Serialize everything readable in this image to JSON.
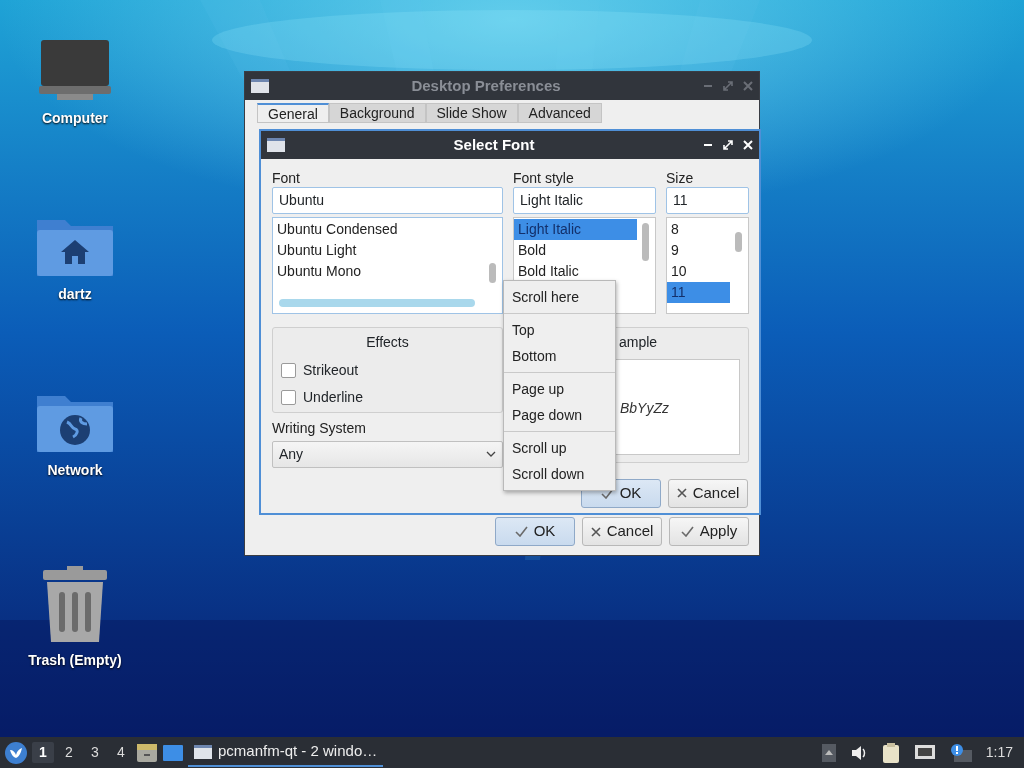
{
  "desktop_icons": [
    {
      "label": "Computer",
      "kind": "computer"
    },
    {
      "label": "dartz",
      "kind": "home"
    },
    {
      "label": "Network",
      "kind": "network"
    },
    {
      "label": "Trash (Empty)",
      "kind": "trash"
    }
  ],
  "back_window": {
    "title": "Desktop Preferences",
    "tabs": [
      {
        "label": "General",
        "selected": true
      },
      {
        "label": "Background",
        "selected": false
      },
      {
        "label": "Slide Show",
        "selected": false
      },
      {
        "label": "Advanced",
        "selected": false
      }
    ],
    "buttons": [
      {
        "label": "OK",
        "kind": "ok",
        "default": true
      },
      {
        "label": "Cancel",
        "kind": "cancel",
        "default": false
      },
      {
        "label": "Apply",
        "kind": "ok",
        "default": false
      }
    ]
  },
  "dialog": {
    "title": "Select Font",
    "font_label": "Font",
    "font_value": "Ubuntu",
    "fonts": [
      {
        "label": "Ubuntu Condensed",
        "selected": false
      },
      {
        "label": "Ubuntu Light",
        "selected": false
      },
      {
        "label": "Ubuntu Mono",
        "selected": false
      }
    ],
    "style_label": "Font style",
    "style_value": "Light Italic",
    "styles": [
      {
        "label": "Light Italic",
        "selected": true
      },
      {
        "label": "Bold",
        "selected": false
      },
      {
        "label": "Bold Italic",
        "selected": false
      }
    ],
    "size_label": "Size",
    "size_value": "11",
    "sizes": [
      {
        "label": "8",
        "selected": false
      },
      {
        "label": "9",
        "selected": false
      },
      {
        "label": "10",
        "selected": false
      },
      {
        "label": "11",
        "selected": true
      }
    ],
    "effects": {
      "title": "Effects",
      "options": [
        {
          "label": "Strikeout",
          "checked": false
        },
        {
          "label": "Underline",
          "checked": false
        }
      ]
    },
    "writing_system": {
      "label": "Writing System",
      "value": "Any"
    },
    "sample": {
      "title": "ample",
      "text": "BbYyZz"
    },
    "buttons": [
      {
        "label": "OK",
        "kind": "ok",
        "default": true
      },
      {
        "label": "Cancel",
        "kind": "cancel",
        "default": false
      }
    ]
  },
  "context_menu": {
    "groups": [
      {
        "items": [
          "Scroll here"
        ]
      },
      {
        "items": [
          "Top",
          "Bottom"
        ]
      },
      {
        "items": [
          "Page up",
          "Page down"
        ]
      },
      {
        "items": [
          "Scroll up",
          "Scroll down"
        ]
      }
    ]
  },
  "taskbar": {
    "workspaces": [
      {
        "label": "1",
        "selected": true
      },
      {
        "label": "2",
        "selected": false
      },
      {
        "label": "3",
        "selected": false
      },
      {
        "label": "4",
        "selected": false
      }
    ],
    "task": "pcmanfm-qt - 2 windo…",
    "clock": "1:17"
  }
}
